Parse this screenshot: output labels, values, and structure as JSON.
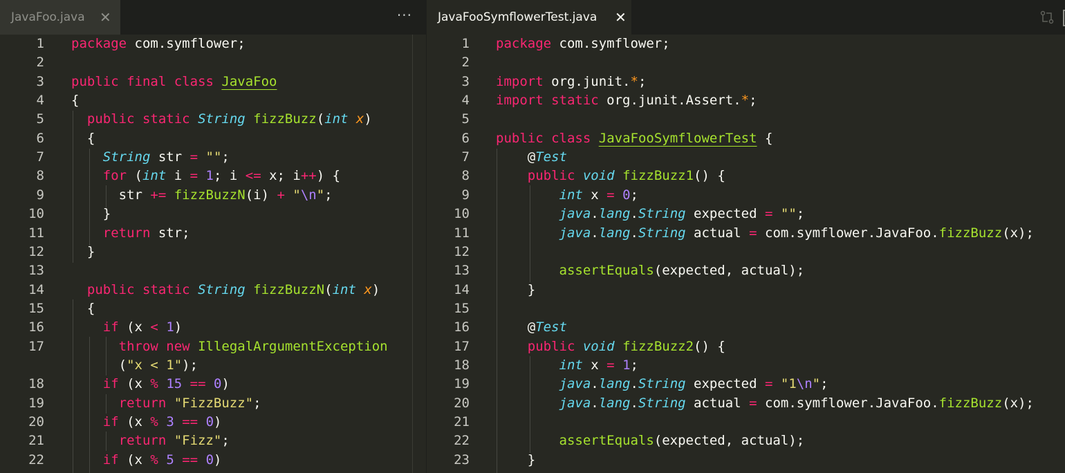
{
  "left_editor": {
    "tab": {
      "title": "JavaFoo.java",
      "close_glyph": "✕"
    },
    "more_actions_glyph": "···",
    "lines": [
      {
        "n": "1",
        "segs": [
          [
            "k",
            "package"
          ],
          [
            "",
            " com.symflower;"
          ]
        ]
      },
      {
        "n": "2",
        "segs": []
      },
      {
        "n": "3",
        "segs": [
          [
            "k",
            "public"
          ],
          [
            "",
            " "
          ],
          [
            "k",
            "final"
          ],
          [
            "",
            " "
          ],
          [
            "k",
            "class"
          ],
          [
            "",
            " "
          ],
          [
            "cls",
            "JavaFoo"
          ]
        ]
      },
      {
        "n": "4",
        "segs": [
          [
            "",
            "{"
          ]
        ]
      },
      {
        "n": "5",
        "segs": [
          [
            "",
            "  "
          ],
          [
            "k",
            "public"
          ],
          [
            "",
            " "
          ],
          [
            "k",
            "static"
          ],
          [
            "",
            " "
          ],
          [
            "t",
            "String"
          ],
          [
            "",
            " "
          ],
          [
            "f",
            "fizzBuzz"
          ],
          [
            "",
            "("
          ],
          [
            "t",
            "int"
          ],
          [
            "",
            " "
          ],
          [
            "p",
            "x"
          ],
          [
            "",
            ")"
          ]
        ]
      },
      {
        "n": "6",
        "segs": [
          [
            "",
            "  {"
          ]
        ]
      },
      {
        "n": "7",
        "segs": [
          [
            "",
            "    "
          ],
          [
            "t",
            "String"
          ],
          [
            "",
            " str "
          ],
          [
            "o",
            "="
          ],
          [
            "",
            " "
          ],
          [
            "s",
            "\"\""
          ],
          [
            "",
            ";"
          ]
        ]
      },
      {
        "n": "8",
        "segs": [
          [
            "",
            "    "
          ],
          [
            "k",
            "for"
          ],
          [
            "",
            " ("
          ],
          [
            "t",
            "int"
          ],
          [
            "",
            " i "
          ],
          [
            "o",
            "="
          ],
          [
            "",
            " "
          ],
          [
            "n",
            "1"
          ],
          [
            "",
            "; i "
          ],
          [
            "o",
            "<="
          ],
          [
            "",
            " x; i"
          ],
          [
            "o",
            "++"
          ],
          [
            "",
            ") {"
          ]
        ]
      },
      {
        "n": "9",
        "segs": [
          [
            "",
            "      str "
          ],
          [
            "o",
            "+="
          ],
          [
            "",
            " "
          ],
          [
            "f",
            "fizzBuzzN"
          ],
          [
            "",
            "(i) "
          ],
          [
            "o",
            "+"
          ],
          [
            "",
            " "
          ],
          [
            "s",
            "\""
          ],
          [
            "n",
            "\\n"
          ],
          [
            "s",
            "\""
          ],
          [
            "",
            ";"
          ]
        ]
      },
      {
        "n": "10",
        "segs": [
          [
            "",
            "    }"
          ]
        ]
      },
      {
        "n": "11",
        "segs": [
          [
            "",
            "    "
          ],
          [
            "k",
            "return"
          ],
          [
            "",
            " str;"
          ]
        ]
      },
      {
        "n": "12",
        "segs": [
          [
            "",
            "  }"
          ]
        ]
      },
      {
        "n": "13",
        "segs": []
      },
      {
        "n": "14",
        "segs": [
          [
            "",
            "  "
          ],
          [
            "k",
            "public"
          ],
          [
            "",
            " "
          ],
          [
            "k",
            "static"
          ],
          [
            "",
            " "
          ],
          [
            "t",
            "String"
          ],
          [
            "",
            " "
          ],
          [
            "f",
            "fizzBuzzN"
          ],
          [
            "",
            "("
          ],
          [
            "t",
            "int"
          ],
          [
            "",
            " "
          ],
          [
            "p",
            "x"
          ],
          [
            "",
            ")"
          ]
        ]
      },
      {
        "n": "15",
        "segs": [
          [
            "",
            "  {"
          ]
        ]
      },
      {
        "n": "16",
        "segs": [
          [
            "",
            "    "
          ],
          [
            "k",
            "if"
          ],
          [
            "",
            " (x "
          ],
          [
            "o",
            "<"
          ],
          [
            "",
            " "
          ],
          [
            "n",
            "1"
          ],
          [
            "",
            ")"
          ]
        ]
      },
      {
        "n": "17",
        "segs": [
          [
            "",
            "      "
          ],
          [
            "k",
            "throw"
          ],
          [
            "",
            " "
          ],
          [
            "k",
            "new"
          ],
          [
            "",
            " "
          ],
          [
            "f",
            "IllegalArgumentException"
          ]
        ]
      },
      {
        "n": "",
        "segs": [
          [
            "",
            "      ("
          ],
          [
            "s",
            "\"x < 1\""
          ],
          [
            "",
            ");"
          ]
        ]
      },
      {
        "n": "18",
        "segs": [
          [
            "",
            "    "
          ],
          [
            "k",
            "if"
          ],
          [
            "",
            " (x "
          ],
          [
            "o",
            "%"
          ],
          [
            "",
            " "
          ],
          [
            "n",
            "15"
          ],
          [
            "",
            " "
          ],
          [
            "o",
            "=="
          ],
          [
            "",
            " "
          ],
          [
            "n",
            "0"
          ],
          [
            "",
            ")"
          ]
        ]
      },
      {
        "n": "19",
        "segs": [
          [
            "",
            "      "
          ],
          [
            "k",
            "return"
          ],
          [
            "",
            " "
          ],
          [
            "s",
            "\"FizzBuzz\""
          ],
          [
            "",
            ";"
          ]
        ]
      },
      {
        "n": "20",
        "segs": [
          [
            "",
            "    "
          ],
          [
            "k",
            "if"
          ],
          [
            "",
            " (x "
          ],
          [
            "o",
            "%"
          ],
          [
            "",
            " "
          ],
          [
            "n",
            "3"
          ],
          [
            "",
            " "
          ],
          [
            "o",
            "=="
          ],
          [
            "",
            " "
          ],
          [
            "n",
            "0"
          ],
          [
            "",
            ")"
          ]
        ]
      },
      {
        "n": "21",
        "segs": [
          [
            "",
            "      "
          ],
          [
            "k",
            "return"
          ],
          [
            "",
            " "
          ],
          [
            "s",
            "\"Fizz\""
          ],
          [
            "",
            ";"
          ]
        ]
      },
      {
        "n": "22",
        "segs": [
          [
            "",
            "    "
          ],
          [
            "k",
            "if"
          ],
          [
            "",
            " (x "
          ],
          [
            "o",
            "%"
          ],
          [
            "",
            " "
          ],
          [
            "n",
            "5"
          ],
          [
            "",
            " "
          ],
          [
            "o",
            "=="
          ],
          [
            "",
            " "
          ],
          [
            "n",
            "0"
          ],
          [
            "",
            ")"
          ]
        ]
      }
    ]
  },
  "right_editor": {
    "tab": {
      "title": "JavaFooSymflowerTest.java",
      "close_glyph": "✕"
    },
    "lines": [
      {
        "n": "1",
        "segs": [
          [
            "k",
            "package"
          ],
          [
            "",
            " com.symflower;"
          ]
        ]
      },
      {
        "n": "2",
        "segs": []
      },
      {
        "n": "3",
        "segs": [
          [
            "k",
            "import"
          ],
          [
            "",
            " org.junit."
          ],
          [
            "p",
            "*"
          ],
          [
            "",
            ";"
          ]
        ]
      },
      {
        "n": "4",
        "segs": [
          [
            "k",
            "import"
          ],
          [
            "",
            " "
          ],
          [
            "k",
            "static"
          ],
          [
            "",
            " org.junit.Assert."
          ],
          [
            "p",
            "*"
          ],
          [
            "",
            ";"
          ]
        ]
      },
      {
        "n": "5",
        "segs": []
      },
      {
        "n": "6",
        "segs": [
          [
            "k",
            "public"
          ],
          [
            "",
            " "
          ],
          [
            "k",
            "class"
          ],
          [
            "",
            " "
          ],
          [
            "cls",
            "JavaFooSymflowerTest"
          ],
          [
            "",
            " {"
          ]
        ]
      },
      {
        "n": "7",
        "segs": [
          [
            "",
            "    @"
          ],
          [
            "t",
            "Test"
          ]
        ]
      },
      {
        "n": "8",
        "segs": [
          [
            "",
            "    "
          ],
          [
            "k",
            "public"
          ],
          [
            "",
            " "
          ],
          [
            "t",
            "void"
          ],
          [
            "",
            " "
          ],
          [
            "f",
            "fizzBuzz1"
          ],
          [
            "",
            "() {"
          ]
        ]
      },
      {
        "n": "9",
        "segs": [
          [
            "",
            "        "
          ],
          [
            "t",
            "int"
          ],
          [
            "",
            " x "
          ],
          [
            "o",
            "="
          ],
          [
            "",
            " "
          ],
          [
            "n",
            "0"
          ],
          [
            "",
            ";"
          ]
        ]
      },
      {
        "n": "10",
        "segs": [
          [
            "",
            "        "
          ],
          [
            "t",
            "java"
          ],
          [
            "",
            "."
          ],
          [
            "t",
            "lang"
          ],
          [
            "",
            "."
          ],
          [
            "t",
            "String"
          ],
          [
            "",
            " expected "
          ],
          [
            "o",
            "="
          ],
          [
            "",
            " "
          ],
          [
            "s",
            "\"\""
          ],
          [
            "",
            ";"
          ]
        ]
      },
      {
        "n": "11",
        "segs": [
          [
            "",
            "        "
          ],
          [
            "t",
            "java"
          ],
          [
            "",
            "."
          ],
          [
            "t",
            "lang"
          ],
          [
            "",
            "."
          ],
          [
            "t",
            "String"
          ],
          [
            "",
            " actual "
          ],
          [
            "o",
            "="
          ],
          [
            "",
            " com.symflower.JavaFoo."
          ],
          [
            "f",
            "fizzBuzz"
          ],
          [
            "",
            "(x);"
          ]
        ]
      },
      {
        "n": "12",
        "segs": []
      },
      {
        "n": "13",
        "segs": [
          [
            "",
            "        "
          ],
          [
            "f",
            "assertEquals"
          ],
          [
            "",
            "(expected, actual);"
          ]
        ]
      },
      {
        "n": "14",
        "segs": [
          [
            "",
            "    }"
          ]
        ]
      },
      {
        "n": "15",
        "segs": []
      },
      {
        "n": "16",
        "segs": [
          [
            "",
            "    @"
          ],
          [
            "t",
            "Test"
          ]
        ]
      },
      {
        "n": "17",
        "segs": [
          [
            "",
            "    "
          ],
          [
            "k",
            "public"
          ],
          [
            "",
            " "
          ],
          [
            "t",
            "void"
          ],
          [
            "",
            " "
          ],
          [
            "f",
            "fizzBuzz2"
          ],
          [
            "",
            "() {"
          ]
        ]
      },
      {
        "n": "18",
        "segs": [
          [
            "",
            "        "
          ],
          [
            "t",
            "int"
          ],
          [
            "",
            " x "
          ],
          [
            "o",
            "="
          ],
          [
            "",
            " "
          ],
          [
            "n",
            "1"
          ],
          [
            "",
            ";"
          ]
        ]
      },
      {
        "n": "19",
        "segs": [
          [
            "",
            "        "
          ],
          [
            "t",
            "java"
          ],
          [
            "",
            "."
          ],
          [
            "t",
            "lang"
          ],
          [
            "",
            "."
          ],
          [
            "t",
            "String"
          ],
          [
            "",
            " expected "
          ],
          [
            "o",
            "="
          ],
          [
            "",
            " "
          ],
          [
            "s",
            "\"1"
          ],
          [
            "n",
            "\\n"
          ],
          [
            "s",
            "\""
          ],
          [
            "",
            ";"
          ]
        ]
      },
      {
        "n": "20",
        "segs": [
          [
            "",
            "        "
          ],
          [
            "t",
            "java"
          ],
          [
            "",
            "."
          ],
          [
            "t",
            "lang"
          ],
          [
            "",
            "."
          ],
          [
            "t",
            "String"
          ],
          [
            "",
            " actual "
          ],
          [
            "o",
            "="
          ],
          [
            "",
            " com.symflower.JavaFoo."
          ],
          [
            "f",
            "fizzBuzz"
          ],
          [
            "",
            "(x);"
          ]
        ]
      },
      {
        "n": "21",
        "segs": []
      },
      {
        "n": "22",
        "segs": [
          [
            "",
            "        "
          ],
          [
            "f",
            "assertEquals"
          ],
          [
            "",
            "(expected, actual);"
          ]
        ]
      },
      {
        "n": "23",
        "segs": [
          [
            "",
            "    }"
          ]
        ]
      }
    ]
  },
  "colors": {
    "background": "#272822",
    "keyword": "#f92672",
    "type": "#66d9ef",
    "function": "#a6e22e",
    "string": "#e6db74",
    "number": "#ae81ff",
    "parameter": "#fd971f"
  },
  "icons": {
    "more_actions": "ellipsis-icon",
    "compare": "compare-changes-icon",
    "close": "close-icon"
  }
}
